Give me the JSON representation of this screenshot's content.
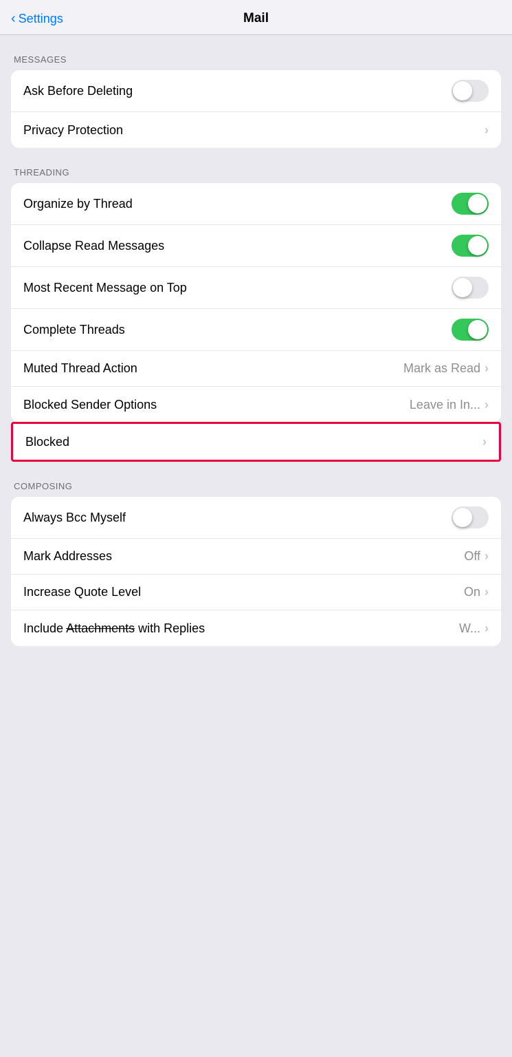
{
  "header": {
    "back_label": "Settings",
    "title": "Mail"
  },
  "sections": [
    {
      "id": "messages",
      "label": "MESSAGES",
      "items": [
        {
          "id": "ask-before-deleting",
          "label": "Ask Before Deleting",
          "type": "toggle",
          "value": false
        },
        {
          "id": "privacy-protection",
          "label": "Privacy Protection",
          "type": "nav",
          "value": ""
        }
      ]
    },
    {
      "id": "threading",
      "label": "THREADING",
      "items": [
        {
          "id": "organize-by-thread",
          "label": "Organize by Thread",
          "type": "toggle",
          "value": true
        },
        {
          "id": "collapse-read-messages",
          "label": "Collapse Read Messages",
          "type": "toggle",
          "value": true
        },
        {
          "id": "most-recent-message",
          "label": "Most Recent Message on Top",
          "type": "toggle",
          "value": false
        },
        {
          "id": "complete-threads",
          "label": "Complete Threads",
          "type": "toggle",
          "value": true
        },
        {
          "id": "muted-thread-action",
          "label": "Muted Thread Action",
          "type": "nav",
          "value": "Mark as Read"
        },
        {
          "id": "blocked-sender-options",
          "label": "Blocked Sender Options",
          "type": "nav",
          "value": "Leave in In..."
        },
        {
          "id": "blocked",
          "label": "Blocked",
          "type": "nav",
          "value": "",
          "highlighted": true
        }
      ]
    },
    {
      "id": "composing",
      "label": "COMPOSING",
      "items": [
        {
          "id": "always-bcc-myself",
          "label": "Always Bcc Myself",
          "type": "toggle",
          "value": false
        },
        {
          "id": "mark-addresses",
          "label": "Mark Addresses",
          "type": "nav",
          "value": "Off"
        },
        {
          "id": "increase-quote-level",
          "label": "Increase Quote Level",
          "type": "nav",
          "value": "On"
        },
        {
          "id": "include-attachments",
          "label": "Include Attachments with Replies",
          "label_partial_strike": true,
          "strike_start": 8,
          "type": "nav",
          "value": "W..."
        }
      ]
    }
  ],
  "icons": {
    "chevron_left": "‹",
    "chevron_right": "›"
  }
}
